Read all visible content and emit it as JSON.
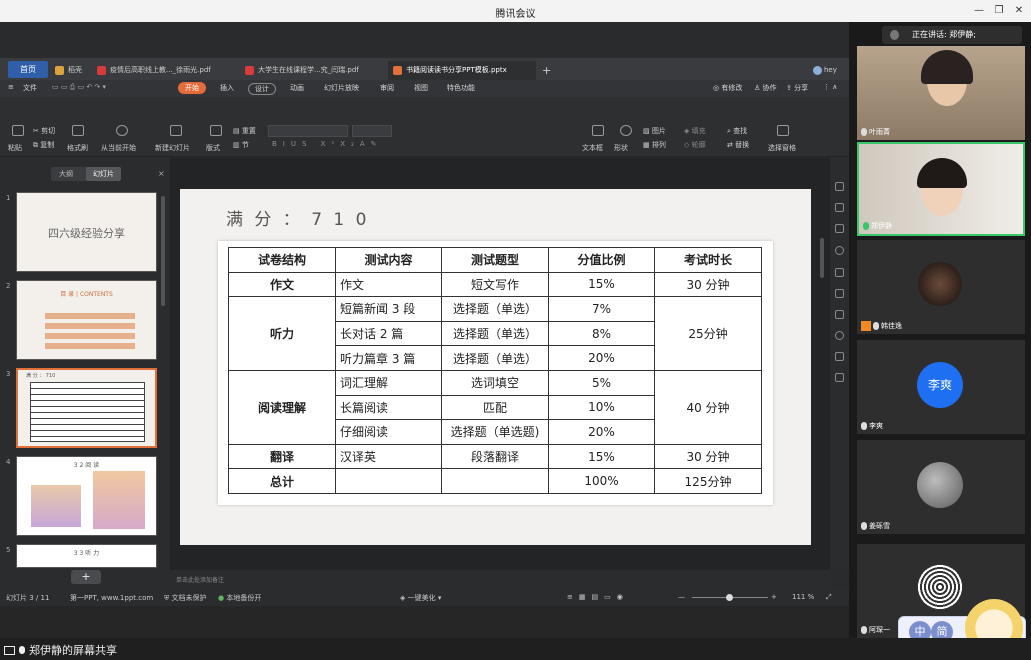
{
  "window": {
    "title": "腾讯会议"
  },
  "wps": {
    "home_tab": "首页",
    "tabs": [
      {
        "label": "稻壳",
        "color": "#d9a23a"
      },
      {
        "label": "疫情后高职线上教..._徐雨光.pdf",
        "color": "#d83b3b"
      },
      {
        "label": "大学生在线课程学...究_闫瑞.pdf",
        "color": "#d83b3b"
      },
      {
        "label": "书籍阅读读书分享PPT模板.pptx",
        "color": "#e0713b"
      }
    ],
    "user": "hey",
    "menu": [
      "文件",
      "开始",
      "插入",
      "设计",
      "动画",
      "幻灯片放映",
      "审阅",
      "视图",
      "特色功能"
    ],
    "menu_active": "开始",
    "menu_right": [
      "有修改",
      "协作",
      "分享"
    ],
    "toolbar": {
      "paste": "粘贴",
      "cut": "剪切",
      "copy": "复制",
      "format_painter": "格式刷",
      "play_from_current": "从当前开始",
      "new_slide": "新建幻灯片",
      "layout": "版式",
      "section": "节",
      "reset": "重置",
      "textbox": "文本框",
      "shape": "形状",
      "picture": "图片",
      "arrange": "排列",
      "fill": "填充",
      "outline": "轮廓",
      "find": "查找",
      "replace": "替换",
      "select_pane": "选择窗格"
    },
    "panel": {
      "tabs": [
        "大纲",
        "幻灯片"
      ],
      "active": "幻灯片"
    },
    "thumbnails": [
      {
        "num": "1",
        "title": "四六级经验分享"
      },
      {
        "num": "2",
        "title": "目 录 | CONTENTS"
      },
      {
        "num": "3",
        "title": "满 分 ： 710"
      },
      {
        "num": "4",
        "title": "3 2 阅 读"
      },
      {
        "num": "5",
        "title": "3 3 听 力"
      }
    ],
    "notes_placeholder": "单击此处添加备注",
    "status": {
      "slide": "幻灯片 3 / 11",
      "theme": "第一PPT, www.1ppt.com",
      "protect": "文档未保护",
      "backup": "本地备份开",
      "beautify": "一键美化",
      "zoom": "111 %"
    }
  },
  "slide": {
    "title": "满 分 ： 7 1 0",
    "headers": [
      "试卷结构",
      "测试内容",
      "测试题型",
      "分值比例",
      "考试时长"
    ],
    "rows": {
      "writing": {
        "section": "作文",
        "content": "作文",
        "type": "短文写作",
        "ratio": "15%",
        "time": "30 分钟"
      },
      "listening": {
        "section": "听力",
        "time": "25分钟",
        "items": [
          {
            "content": "短篇新闻 3 段",
            "type": "选择题（单选）",
            "ratio": "7%"
          },
          {
            "content": "长对话 2 篇",
            "type": "选择题（单选）",
            "ratio": "8%"
          },
          {
            "content": "听力篇章 3 篇",
            "type": "选择题（单选）",
            "ratio": "20%"
          }
        ]
      },
      "reading": {
        "section": "阅读理解",
        "time": "40 分钟",
        "items": [
          {
            "content": "词汇理解",
            "type": "选词填空",
            "ratio": "5%"
          },
          {
            "content": "长篇阅读",
            "type": "匹配",
            "ratio": "10%"
          },
          {
            "content": "仔细阅读",
            "type": "选择题（单选题)",
            "ratio": "20%"
          }
        ]
      },
      "translation": {
        "section": "翻译",
        "content": "汉译英",
        "type": "段落翻译",
        "ratio": "15%",
        "time": "30 分钟"
      },
      "total": {
        "section": "总计",
        "ratio": "100%",
        "time": "125分钟"
      }
    }
  },
  "meeting": {
    "speaking_label": "正在讲话: 郑伊静;",
    "share_label": "郑伊静的屏幕共享",
    "participants": [
      {
        "name": "叶雨菁"
      },
      {
        "name": "郑伊静"
      },
      {
        "name": "韩佳逸"
      },
      {
        "name": "李爽",
        "avatar_text": "李爽",
        "avatar_color": "#1f6ff2"
      },
      {
        "name": "姜砾雪"
      },
      {
        "name": "阿琛一"
      }
    ],
    "ime": [
      "中",
      "简"
    ]
  }
}
